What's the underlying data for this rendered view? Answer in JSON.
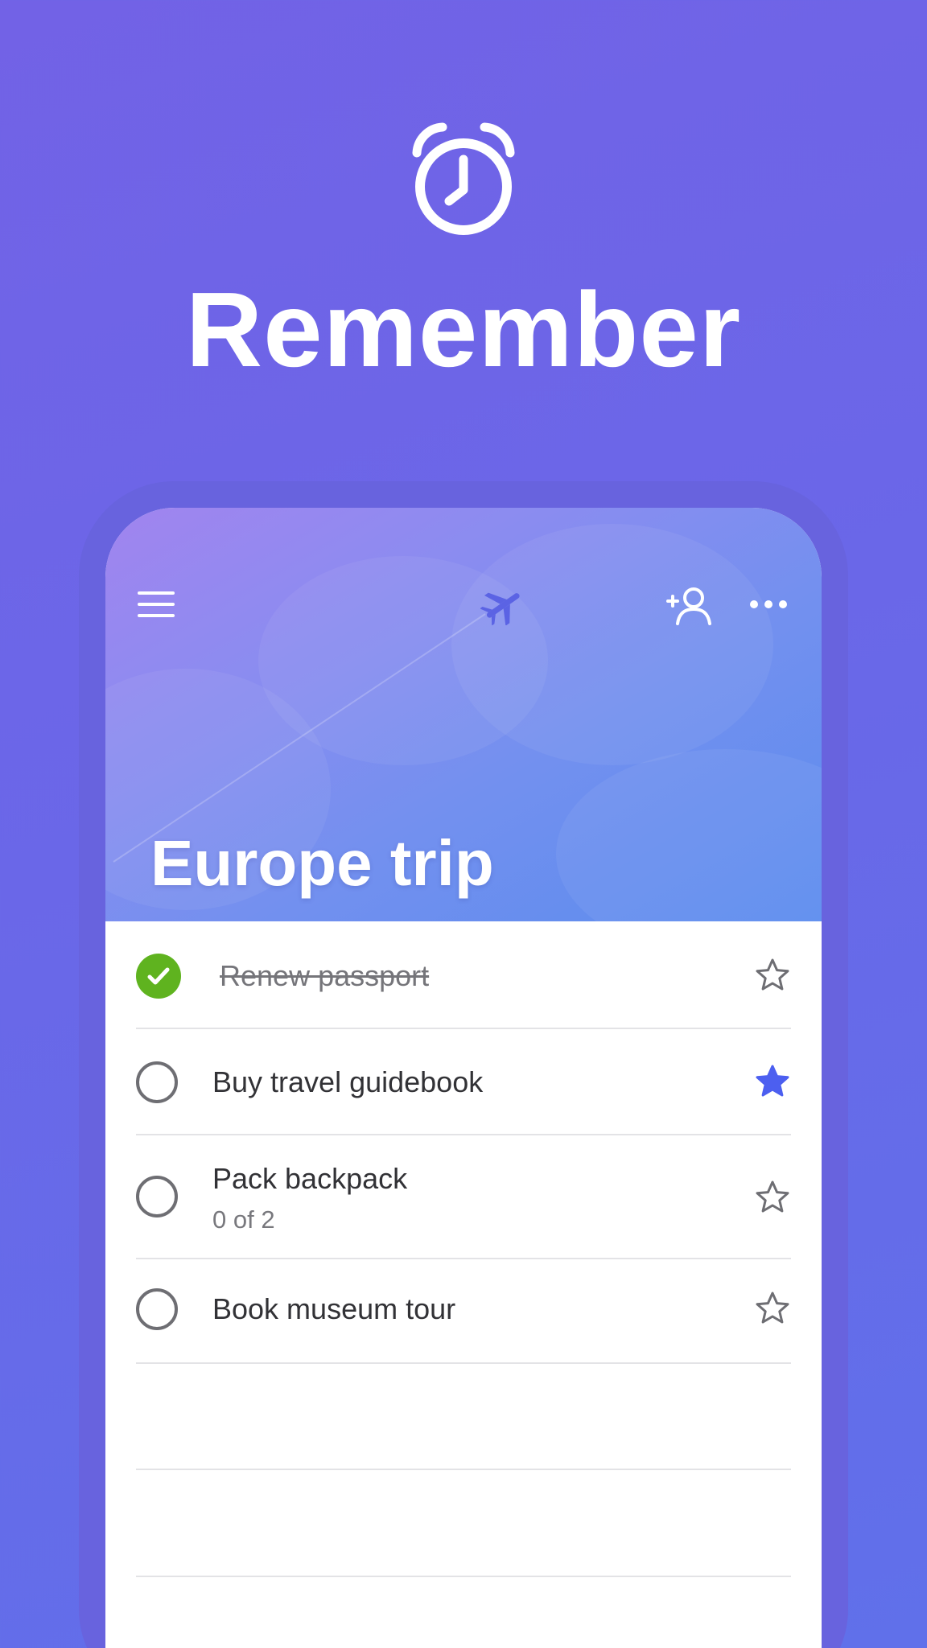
{
  "promo": {
    "headline": "Remember",
    "icon": "alarm-clock-icon"
  },
  "list": {
    "title": "Europe trip",
    "theme_icon": "airplane-icon",
    "toolbar": {
      "menu_icon": "hamburger-menu-icon",
      "share_icon": "add-person-icon",
      "more_icon": "more-dots-icon"
    },
    "tasks": [
      {
        "title": "Renew passport",
        "completed": true,
        "starred": false,
        "subtitle": ""
      },
      {
        "title": "Buy travel guidebook",
        "completed": false,
        "starred": true,
        "subtitle": ""
      },
      {
        "title": "Pack backpack",
        "completed": false,
        "starred": false,
        "subtitle": "0 of 2"
      },
      {
        "title": "Book museum tour",
        "completed": false,
        "starred": false,
        "subtitle": ""
      }
    ]
  },
  "colors": {
    "background": "#6a67e8",
    "completed_check": "#5fb31f",
    "star_active": "#4c5ff0",
    "star_inactive": "#6e6e73",
    "text_primary": "#323236",
    "text_secondary": "#78787d"
  }
}
